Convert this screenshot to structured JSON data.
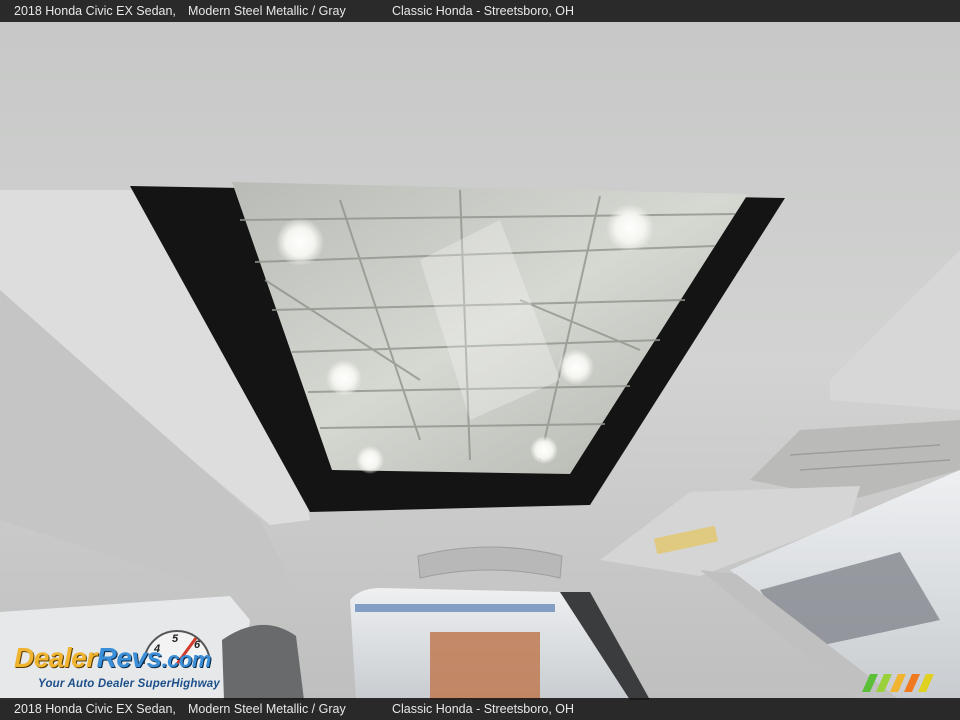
{
  "caption": {
    "vehicle": "2018 Honda Civic EX Sedan,",
    "color": "Modern Steel Metallic / Gray",
    "dealer": "Classic Honda - Streetsboro, OH"
  },
  "watermark": {
    "brand_dealer": "Dealer",
    "brand_revs": "Revs",
    "brand_com": ".com",
    "tagline": "Your Auto Dealer SuperHighway",
    "gauge_digits": [
      "4",
      "5",
      "6"
    ]
  },
  "colors": {
    "headliner": "#cdcecd",
    "glass": "#c9ccc6",
    "frame": "#141414",
    "logo_gold": "#f0b430",
    "logo_blue": "#3b8fd8"
  }
}
